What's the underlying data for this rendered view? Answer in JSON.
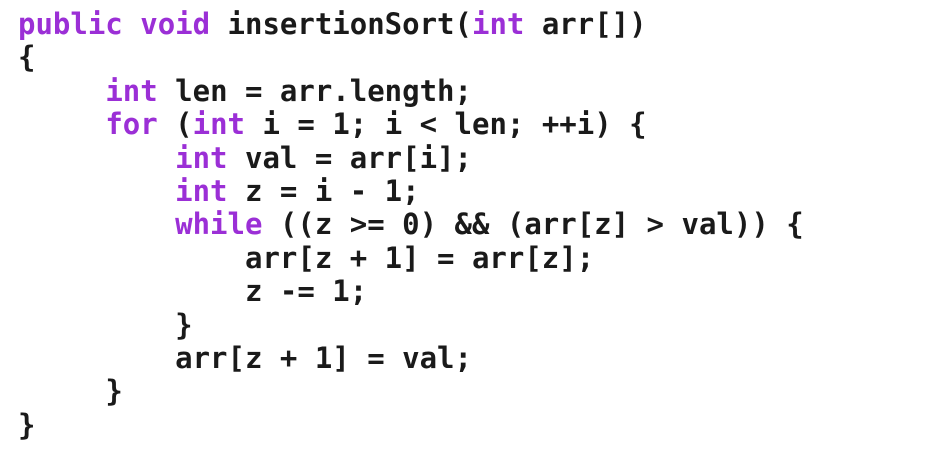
{
  "colors": {
    "keyword": "#9b2fd6",
    "text": "#1a1a1a",
    "background": "#ffffff"
  },
  "code": {
    "lines": [
      {
        "indent": "",
        "tokens": [
          {
            "t": "public",
            "kw": true
          },
          {
            "t": " ",
            "kw": false
          },
          {
            "t": "void",
            "kw": true
          },
          {
            "t": " insertionSort(",
            "kw": false
          },
          {
            "t": "int",
            "kw": true
          },
          {
            "t": " arr[])",
            "kw": false
          }
        ]
      },
      {
        "indent": "",
        "tokens": [
          {
            "t": "{",
            "kw": false
          }
        ]
      },
      {
        "indent": "     ",
        "tokens": [
          {
            "t": "int",
            "kw": true
          },
          {
            "t": " len = arr.length;",
            "kw": false
          }
        ]
      },
      {
        "indent": "     ",
        "tokens": [
          {
            "t": "for",
            "kw": true
          },
          {
            "t": " (",
            "kw": false
          },
          {
            "t": "int",
            "kw": true
          },
          {
            "t": " i = 1; i < len; ++i) {",
            "kw": false
          }
        ]
      },
      {
        "indent": "         ",
        "tokens": [
          {
            "t": "int",
            "kw": true
          },
          {
            "t": " val = arr[i];",
            "kw": false
          }
        ]
      },
      {
        "indent": "         ",
        "tokens": [
          {
            "t": "int",
            "kw": true
          },
          {
            "t": " z = i - 1;",
            "kw": false
          }
        ]
      },
      {
        "indent": "         ",
        "tokens": [
          {
            "t": "while",
            "kw": true
          },
          {
            "t": " ((z >= 0) && (arr[z] > val)) {",
            "kw": false
          }
        ]
      },
      {
        "indent": "             ",
        "tokens": [
          {
            "t": "arr[z + 1] = arr[z];",
            "kw": false
          }
        ]
      },
      {
        "indent": "             ",
        "tokens": [
          {
            "t": "z -= 1;",
            "kw": false
          }
        ]
      },
      {
        "indent": "         ",
        "tokens": [
          {
            "t": "}",
            "kw": false
          }
        ]
      },
      {
        "indent": "         ",
        "tokens": [
          {
            "t": "arr[z + 1] = val;",
            "kw": false
          }
        ]
      },
      {
        "indent": "     ",
        "tokens": [
          {
            "t": "}",
            "kw": false
          }
        ]
      },
      {
        "indent": "",
        "tokens": [
          {
            "t": "}",
            "kw": false
          }
        ]
      }
    ]
  }
}
